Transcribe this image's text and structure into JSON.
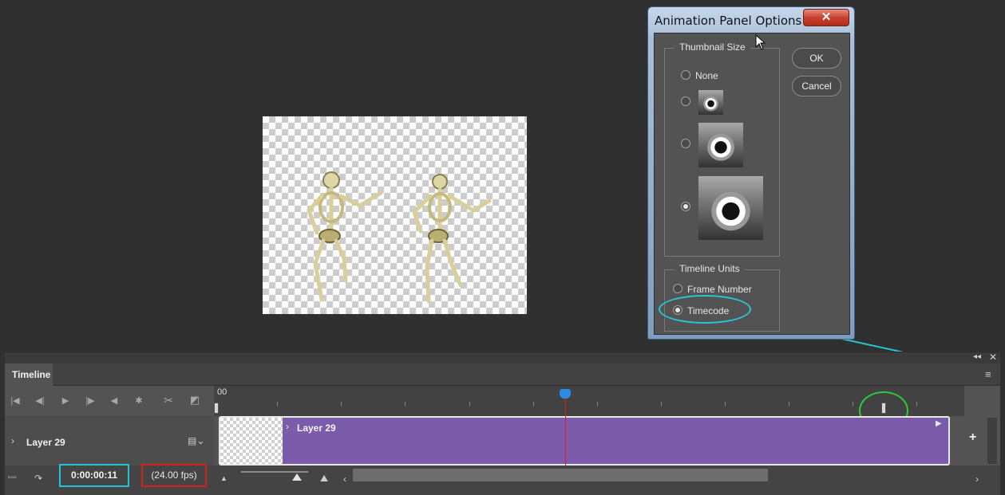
{
  "dialog": {
    "title": "Animation Panel Options",
    "close_label": "✕",
    "thumbnail_group_label": "Thumbnail Size",
    "thumbnail_options": [
      {
        "label": "None",
        "selected": false
      },
      {
        "label": "",
        "selected": false
      },
      {
        "label": "",
        "selected": false
      },
      {
        "label": "",
        "selected": true
      }
    ],
    "units_group_label": "Timeline Units",
    "units_options": [
      {
        "label": "Frame Number",
        "selected": false
      },
      {
        "label": "Timecode",
        "selected": true
      }
    ],
    "ok_label": "OK",
    "cancel_label": "Cancel"
  },
  "timeline": {
    "tab_label": "Timeline",
    "ruler_start": "00",
    "layer_name": "Layer 29",
    "clip_label": "Layer 29",
    "timecode": "0:00:00:11",
    "fps": "(24.00 fps)",
    "add_label": "+"
  },
  "colors": {
    "clip": "#7a5cab",
    "playhead": "#e01e1e",
    "timecode_highlight": "#22c3d4",
    "fps_highlight": "#d42020",
    "annotation_arrow": "#27c6d6",
    "end_handle_highlight": "#2fca3c"
  }
}
